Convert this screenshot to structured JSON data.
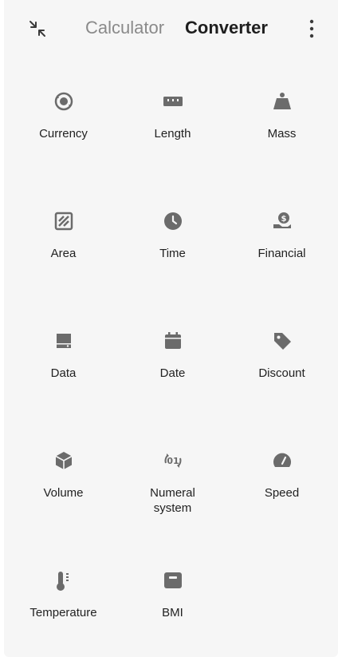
{
  "header": {
    "tab_calculator": "Calculator",
    "tab_converter": "Converter",
    "collapse_icon": "collapse-icon",
    "more_icon": "more-vert-icon"
  },
  "categories": [
    {
      "label": "Currency",
      "icon": "currency-icon"
    },
    {
      "label": "Length",
      "icon": "ruler-icon"
    },
    {
      "label": "Mass",
      "icon": "weight-icon"
    },
    {
      "label": "Area",
      "icon": "area-icon"
    },
    {
      "label": "Time",
      "icon": "clock-icon"
    },
    {
      "label": "Financial",
      "icon": "financial-icon"
    },
    {
      "label": "Data",
      "icon": "storage-icon"
    },
    {
      "label": "Date",
      "icon": "calendar-icon"
    },
    {
      "label": "Discount",
      "icon": "tag-icon"
    },
    {
      "label": "Volume",
      "icon": "cube-icon"
    },
    {
      "label_line1": "Numeral",
      "label_line2": "system",
      "icon": "numeral-icon"
    },
    {
      "label": "Speed",
      "icon": "speedometer-icon"
    },
    {
      "label": "Temperature",
      "icon": "thermometer-icon"
    },
    {
      "label": "BMI",
      "icon": "scale-icon"
    }
  ],
  "colors": {
    "background": "#f6f6f6",
    "icon": "#6b6b6b",
    "text": "#222222",
    "tab_inactive": "#8a8a8a"
  }
}
